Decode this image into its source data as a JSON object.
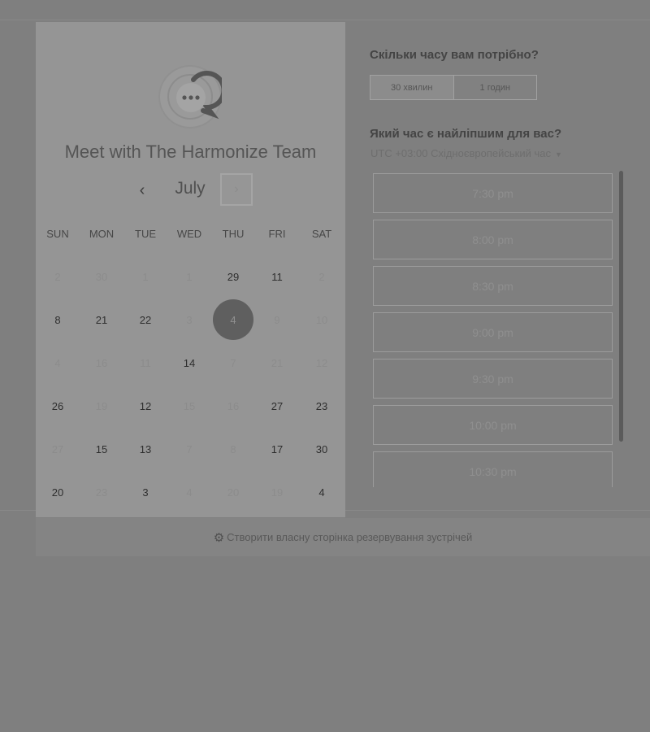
{
  "scheduler": {
    "title": "Meet with The Harmonize Team",
    "month": "July",
    "prev_icon": "chevron-left-icon",
    "next_icon": "chevron-right-icon",
    "weekdays": [
      "SUN",
      "MON",
      "TUE",
      "WED",
      "THU",
      "FRI",
      "SAT"
    ],
    "weeks": [
      [
        "2",
        "30",
        "1",
        "1",
        "29",
        "11",
        "2"
      ],
      [
        "8",
        "21",
        "22",
        "3",
        "4",
        "9",
        "10"
      ],
      [
        "4",
        "16",
        "11",
        "14",
        "7",
        "21",
        "12"
      ],
      [
        "26",
        "19",
        "12",
        "15",
        "16",
        "27",
        "23"
      ],
      [
        "27",
        "15",
        "13",
        "7",
        "8",
        "17",
        "30"
      ],
      [
        "20",
        "23",
        "3",
        "4",
        "20",
        "19",
        "4"
      ]
    ]
  },
  "duration": {
    "question": "Скільки часу вам потрібно?",
    "options": [
      "30 хвилин",
      "1 годин"
    ],
    "selected": "30 хвилин"
  },
  "times": {
    "question": "Який час є найліпшим для вас?",
    "timezone": "UTC +03:00 Східноєвропейський час",
    "slots": [
      "7:30 pm",
      "8:00 pm",
      "8:30 pm",
      "9:00 pm",
      "9:30 pm",
      "10:00 pm",
      "10:30 pm"
    ]
  },
  "footer": {
    "icon": "hubspot-sprocket-icon",
    "text": "Створити власну сторінка резервування зустрічей"
  },
  "colors": {
    "overlay": "#7f7f7f",
    "selected_day": "#5f5f5f",
    "card": "#959595"
  }
}
